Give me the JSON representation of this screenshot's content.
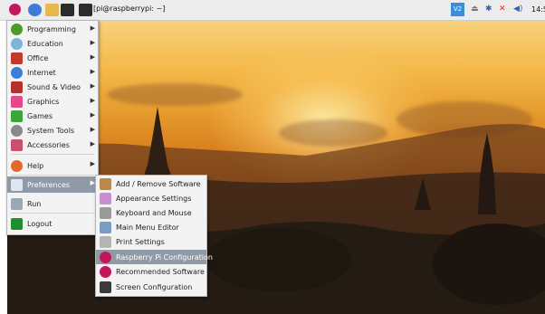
{
  "taskbar": {
    "terminal_label": "[pi@raspberrypi: ~]",
    "clock": "14:5"
  },
  "main_menu": {
    "items": [
      {
        "label": "Programming",
        "icon": "programming-icon"
      },
      {
        "label": "Education",
        "icon": "education-icon"
      },
      {
        "label": "Office",
        "icon": "office-icon"
      },
      {
        "label": "Internet",
        "icon": "internet-icon"
      },
      {
        "label": "Sound & Video",
        "icon": "sound-video-icon"
      },
      {
        "label": "Graphics",
        "icon": "graphics-icon"
      },
      {
        "label": "Games",
        "icon": "games-icon"
      },
      {
        "label": "System Tools",
        "icon": "system-tools-icon"
      },
      {
        "label": "Accessories",
        "icon": "accessories-icon"
      },
      {
        "label": "Help",
        "icon": "help-icon"
      },
      {
        "label": "Preferences",
        "icon": "preferences-icon"
      },
      {
        "label": "Run",
        "icon": "run-icon"
      },
      {
        "label": "Logout",
        "icon": "logout-icon"
      }
    ]
  },
  "preferences_menu": {
    "items": [
      {
        "label": "Add / Remove Software",
        "icon": "package-icon"
      },
      {
        "label": "Appearance Settings",
        "icon": "appearance-icon"
      },
      {
        "label": "Keyboard and Mouse",
        "icon": "keyboard-icon"
      },
      {
        "label": "Main Menu Editor",
        "icon": "menu-editor-icon"
      },
      {
        "label": "Print Settings",
        "icon": "printer-icon"
      },
      {
        "label": "Raspberry Pi Configuration",
        "icon": "raspberry-icon"
      },
      {
        "label": "Recommended Software",
        "icon": "raspberry-icon"
      },
      {
        "label": "Screen Configuration",
        "icon": "monitor-icon"
      }
    ]
  },
  "colors": {
    "menu_highlight": "#8f9aa6",
    "taskbar_bg": "#ececec"
  }
}
